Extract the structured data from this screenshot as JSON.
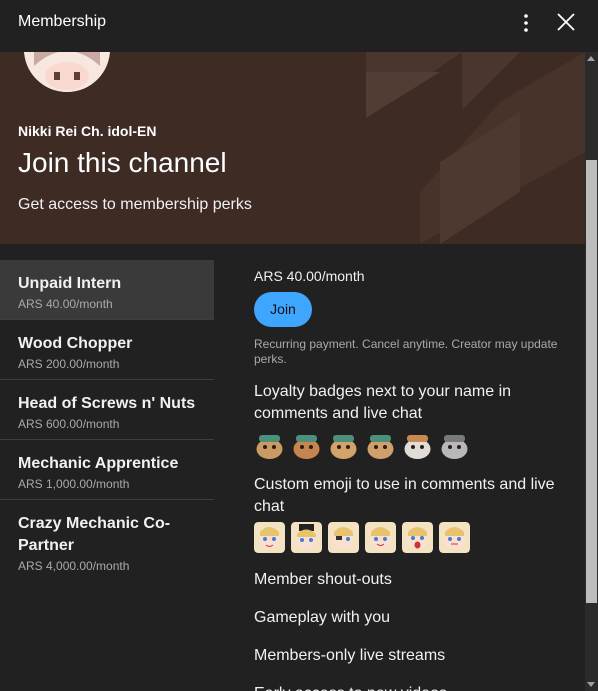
{
  "header": {
    "title": "Membership",
    "more_icon": "more-vert-icon",
    "close_icon": "close-icon"
  },
  "banner": {
    "channel_name": "Nikki Rei Ch. idol-EN",
    "title": "Join this channel",
    "subtitle": "Get access to membership perks"
  },
  "tiers": [
    {
      "name": "Unpaid Intern",
      "price": "ARS 40.00/month",
      "selected": true
    },
    {
      "name": "Wood Chopper",
      "price": "ARS 200.00/month"
    },
    {
      "name": "Head of Screws n' Nuts",
      "price": "ARS 600.00/month"
    },
    {
      "name": "Mechanic Apprentice",
      "price": "ARS 1,000.00/month"
    },
    {
      "name": "Crazy Mechanic Co-Partner",
      "price": "ARS 4,000.00/month"
    }
  ],
  "details": {
    "price": "ARS 40.00/month",
    "join_label": "Join",
    "note": "Recurring payment. Cancel anytime. Creator may update perks.",
    "perks": [
      "Loyalty badges next to your name in comments and live chat",
      "Custom emoji to use in comments and live chat",
      "Member shout-outs",
      "Gameplay with you",
      "Members-only live streams",
      "Early access to new videos"
    ]
  },
  "colors": {
    "background": "#212121",
    "banner": "#3d2b24",
    "accent": "#3ea6ff",
    "selected_tier": "#3a3a3a"
  }
}
